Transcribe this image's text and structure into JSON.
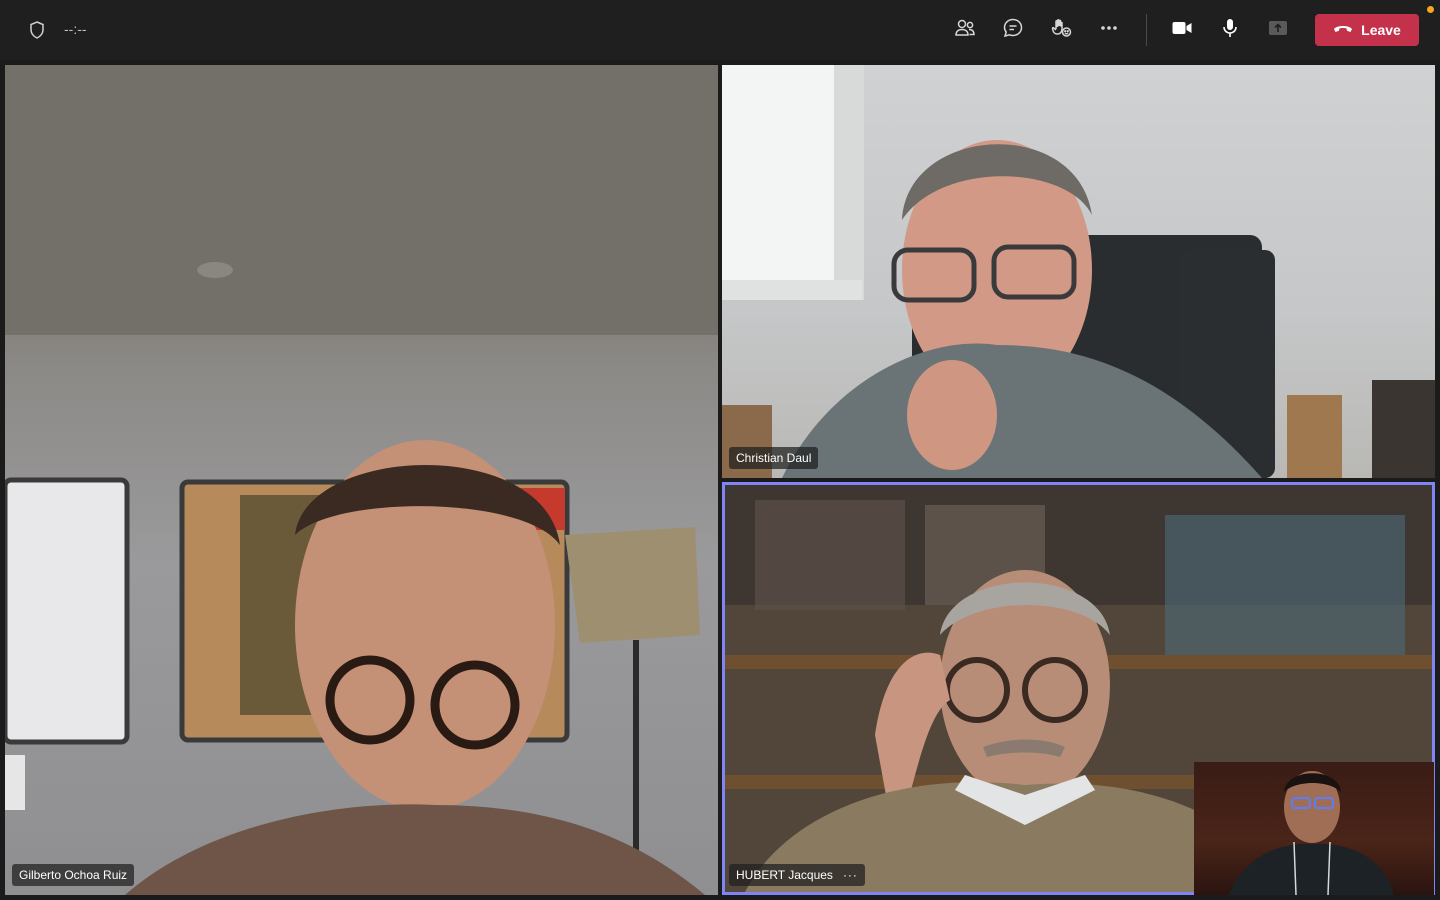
{
  "toolbar": {
    "timer": "--:--",
    "leave_label": "Leave",
    "icons": [
      "shield-icon",
      "people-icon",
      "chat-icon",
      "react-icon",
      "more-icon",
      "camera-icon",
      "microphone-icon",
      "share-icon",
      "phone-hangup-icon"
    ]
  },
  "participants": [
    {
      "name": "Gilberto Ochoa Ruiz"
    },
    {
      "name": "Christian Daul"
    },
    {
      "name": "HUBERT Jacques",
      "more": "···"
    }
  ],
  "colors": {
    "leave_button": "#c4314b",
    "active_speaker_border": "#7f85f5",
    "notification_dot": "#f5a623"
  }
}
